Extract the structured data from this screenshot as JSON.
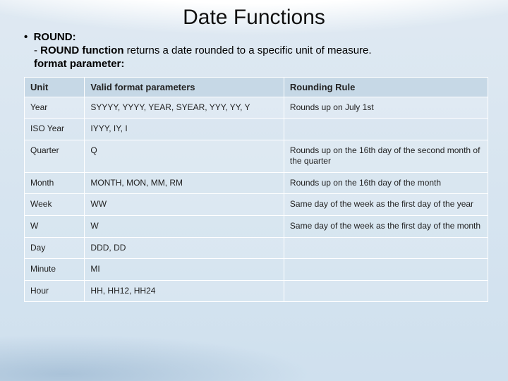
{
  "title": "Date Functions",
  "bullet_label": "ROUND:",
  "round_fn_prefix": "- ",
  "round_fn_bold": "ROUND function",
  "round_fn_rest": " returns a date rounded to a specific unit of measure.",
  "format_param_label": "format parameter:",
  "headers": {
    "unit": "Unit",
    "params": "Valid format parameters",
    "rule": "Rounding Rule"
  },
  "rows": [
    {
      "unit": "Year",
      "params": "SYYYY, YYYY, YEAR, SYEAR, YYY, YY, Y",
      "rule": "Rounds up on July 1st"
    },
    {
      "unit": "ISO Year",
      "params": "IYYY, IY, I",
      "rule": ""
    },
    {
      "unit": "Quarter",
      "params": "Q",
      "rule": "Rounds up on the 16th day of the second month of the quarter"
    },
    {
      "unit": "Month",
      "params": "MONTH, MON, MM, RM",
      "rule": "Rounds up on the 16th day of the month"
    },
    {
      "unit": "Week",
      "params": "WW",
      "rule": "Same day of the week as the first day of the year"
    },
    {
      "unit": "W",
      "params": "W",
      "rule": "Same day of the week as the first day of the month"
    },
    {
      "unit": "Day",
      "params": "DDD, DD",
      "rule": ""
    },
    {
      "unit": "Minute",
      "params": "MI",
      "rule": ""
    },
    {
      "unit": "Hour",
      "params": "HH, HH12, HH24",
      "rule": ""
    }
  ]
}
